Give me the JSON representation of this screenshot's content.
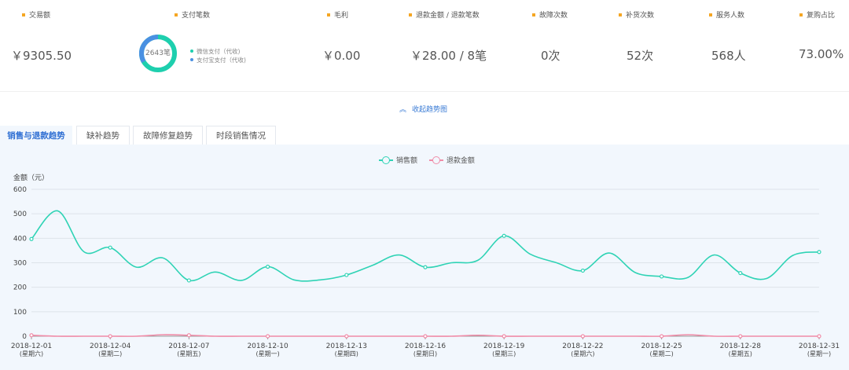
{
  "stats": {
    "transaction_amount": {
      "label": "交易额",
      "value": "￥9305.50"
    },
    "payment_count": {
      "label": "支付笔数",
      "center": "2643笔",
      "legend": [
        {
          "label": "微信支付（代收)",
          "color": "#1ecfae"
        },
        {
          "label": "支付宝支付（代收)",
          "color": "#4a90e2"
        }
      ]
    },
    "gross_profit": {
      "label": "毛利",
      "value": "￥0.00"
    },
    "refund": {
      "label": "退款金额 / 退款笔数",
      "value": "￥28.00 / 8笔"
    },
    "fault_count": {
      "label": "故障次数",
      "value": "0次"
    },
    "restock_count": {
      "label": "补货次数",
      "value": "52次"
    },
    "service_count": {
      "label": "服务人数",
      "value": "568人"
    },
    "repurchase_ratio": {
      "label": "复购占比",
      "value": "73.00%"
    }
  },
  "collapse": {
    "label": "收起趋势图"
  },
  "tabs": [
    {
      "label": "销售与退款趋势",
      "active": true
    },
    {
      "label": "缺补趋势",
      "active": false
    },
    {
      "label": "故障修复趋势",
      "active": false
    },
    {
      "label": "时段销售情况",
      "active": false
    }
  ],
  "colors": {
    "sales": "#2fd3b5",
    "refund": "#f08ca8",
    "accent": "#2f6fd3",
    "bullet": "#f5a623"
  },
  "chart_data": {
    "type": "line",
    "ylabel": "金额（元）",
    "ylim": [
      0,
      600
    ],
    "yticks": [
      0,
      100,
      200,
      300,
      400,
      500,
      600
    ],
    "grid": true,
    "legend_position": "top-center",
    "x": [
      "2018-12-01",
      "2018-12-02",
      "2018-12-03",
      "2018-12-04",
      "2018-12-05",
      "2018-12-06",
      "2018-12-07",
      "2018-12-08",
      "2018-12-09",
      "2018-12-10",
      "2018-12-11",
      "2018-12-12",
      "2018-12-13",
      "2018-12-14",
      "2018-12-15",
      "2018-12-16",
      "2018-12-17",
      "2018-12-18",
      "2018-12-19",
      "2018-12-20",
      "2018-12-21",
      "2018-12-22",
      "2018-12-23",
      "2018-12-24",
      "2018-12-25",
      "2018-12-26",
      "2018-12-27",
      "2018-12-28",
      "2018-12-29",
      "2018-12-30",
      "2018-12-31"
    ],
    "xtick_labels": [
      {
        "date": "2018-12-01",
        "weekday": "(星期六)"
      },
      {
        "date": "2018-12-04",
        "weekday": "(星期二)"
      },
      {
        "date": "2018-12-07",
        "weekday": "(星期五)"
      },
      {
        "date": "2018-12-10",
        "weekday": "(星期一)"
      },
      {
        "date": "2018-12-13",
        "weekday": "(星期四)"
      },
      {
        "date": "2018-12-16",
        "weekday": "(星期日)"
      },
      {
        "date": "2018-12-19",
        "weekday": "(星期三)"
      },
      {
        "date": "2018-12-22",
        "weekday": "(星期六)"
      },
      {
        "date": "2018-12-25",
        "weekday": "(星期二)"
      },
      {
        "date": "2018-12-28",
        "weekday": "(星期五)"
      },
      {
        "date": "2018-12-31",
        "weekday": "(星期一)"
      }
    ],
    "series": [
      {
        "name": "销售额",
        "color": "#2fd3b5",
        "values": [
          397,
          512,
          345,
          362,
          282,
          320,
          228,
          262,
          228,
          284,
          230,
          230,
          250,
          290,
          332,
          282,
          300,
          310,
          410,
          335,
          300,
          268,
          340,
          260,
          244,
          240,
          332,
          258,
          236,
          330,
          344
        ]
      },
      {
        "name": "退款金额",
        "color": "#f08ca8",
        "values": [
          4,
          0,
          0,
          0,
          0,
          6,
          4,
          0,
          0,
          0,
          0,
          0,
          0,
          0,
          0,
          0,
          0,
          4,
          0,
          0,
          0,
          0,
          0,
          0,
          0,
          6,
          0,
          0,
          0,
          0,
          0
        ]
      }
    ]
  }
}
